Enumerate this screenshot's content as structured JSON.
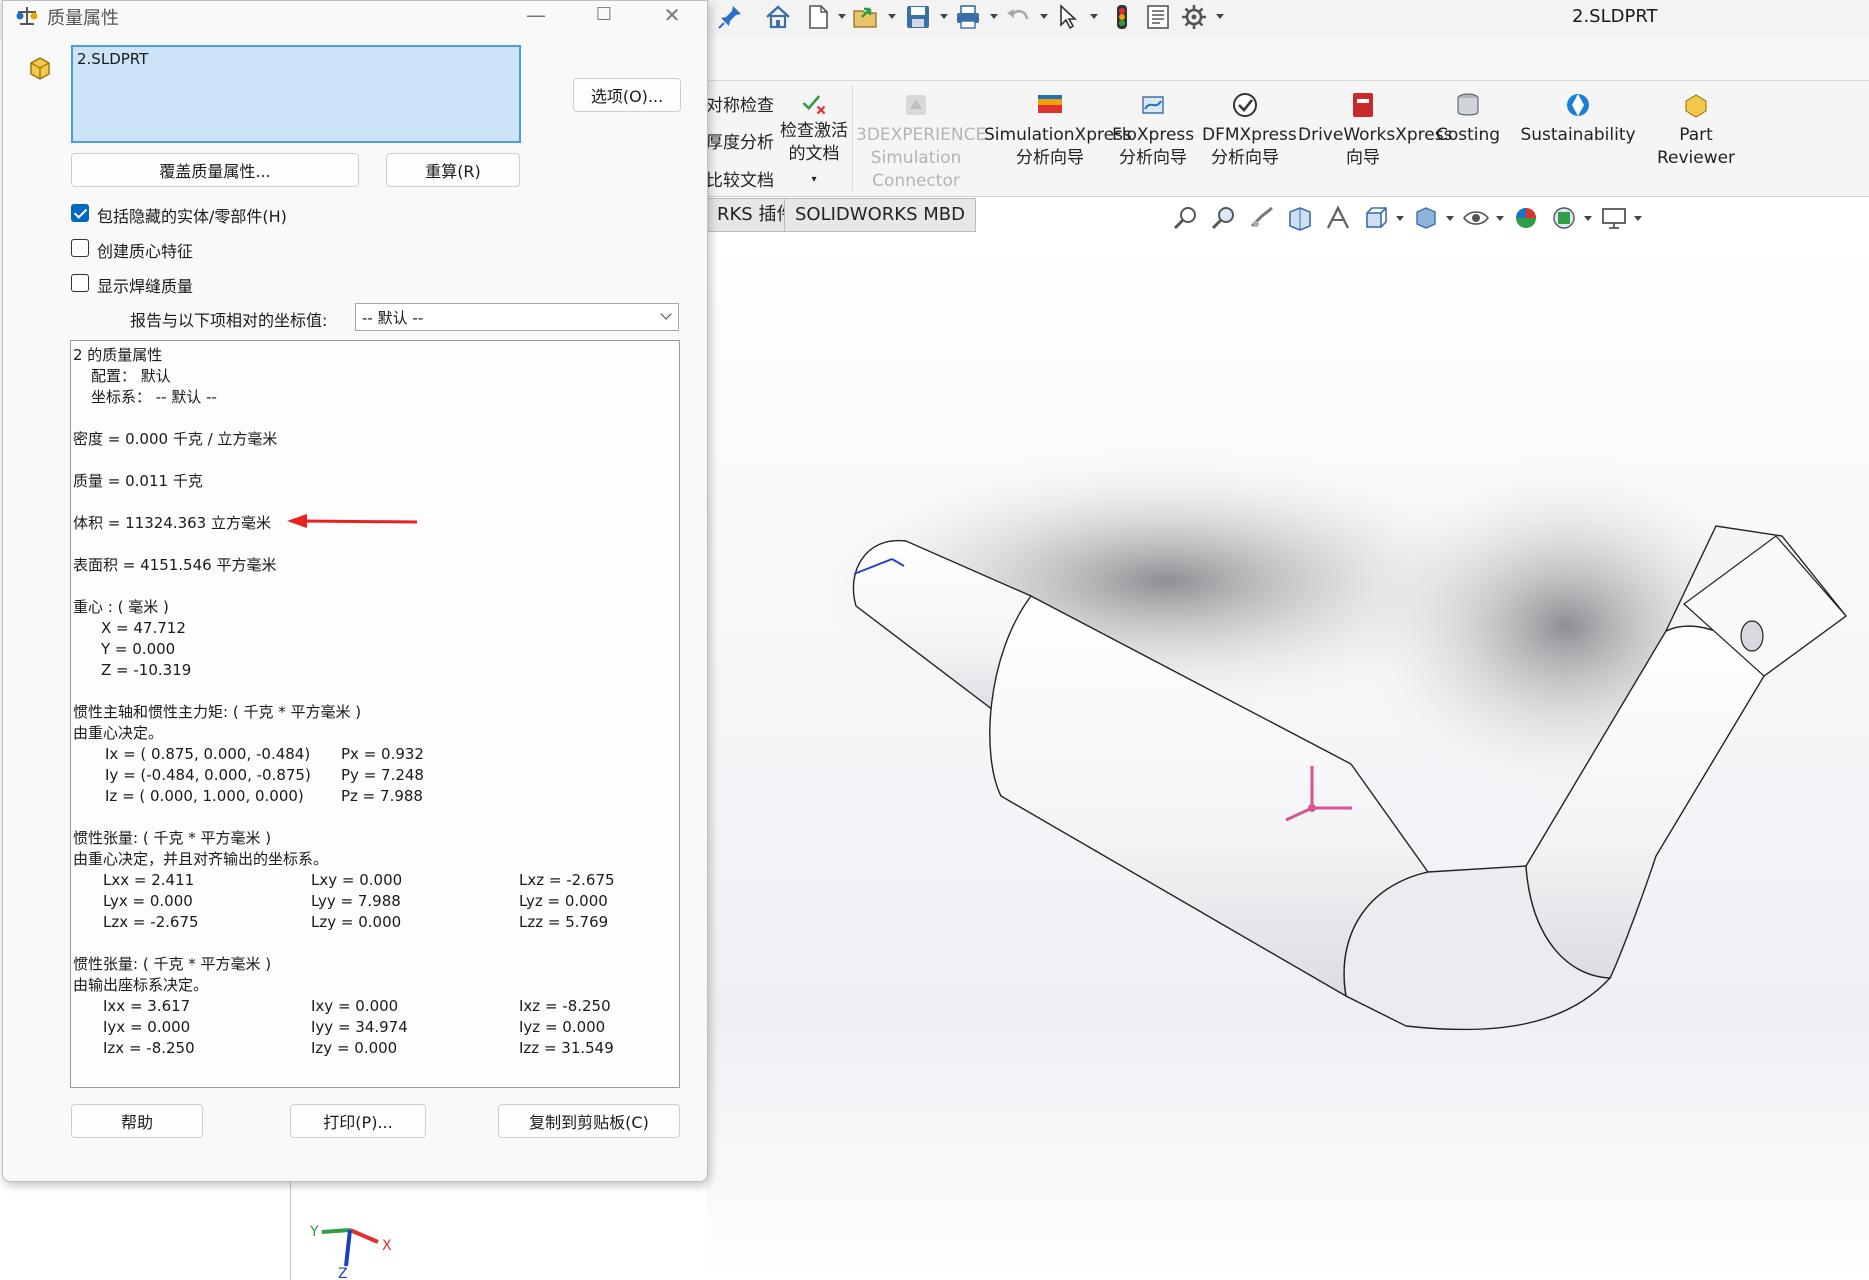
{
  "toolbar": {
    "doc_title": "2.SLDPRT"
  },
  "ribbon": {
    "left_items": [
      "对称检查",
      "厚度分析",
      "比较文档"
    ],
    "check_active_label": "检查激活\n的文档",
    "buttons": [
      {
        "label": "3DEXPERIENCE\nSimulation\nConnector",
        "disabled": true,
        "icon": "3dexperience-icon"
      },
      {
        "label": "SimulationXpress\n分析向导",
        "icon": "simulationxpress-icon"
      },
      {
        "label": "FloXpress\n分析向导",
        "icon": "floxpress-icon"
      },
      {
        "label": "DFMXpress\n分析向导",
        "icon": "dfmxpress-icon"
      },
      {
        "label": "DriveWorksXpress\n向导",
        "icon": "driveworksxpress-icon"
      },
      {
        "label": "Costing",
        "icon": "costing-icon"
      },
      {
        "label": "Sustainability",
        "icon": "sustainability-icon"
      },
      {
        "label": "Part\nReviewer",
        "icon": "part-reviewer-icon"
      }
    ]
  },
  "tabs": [
    "RKS 插件",
    "SOLIDWORKS MBD"
  ],
  "dialog": {
    "title": "质量属性",
    "selection": "2.SLDPRT",
    "options_button": "选项(O)...",
    "override_button": "覆盖质量属性...",
    "recalc_button": "重算(R)",
    "checkboxes": [
      {
        "label": "包括隐藏的实体/零部件(H)",
        "checked": true
      },
      {
        "label": "创建质心特征",
        "checked": false
      },
      {
        "label": "显示焊缝质量",
        "checked": false
      }
    ],
    "coord_label": "报告与以下项相对的坐标值:",
    "coord_value": "-- 默认 --",
    "help_button": "帮助",
    "print_button": "打印(P)...",
    "copy_button": "复制到剪贴板(C)"
  },
  "results": {
    "title": "2 的质量属性",
    "config": "配置： 默认",
    "coord_sys": "坐标系： -- 默认 --",
    "density": "密度 = 0.000 千克 / 立方毫米",
    "mass": "质量 = 0.011 千克",
    "volume": "体积 = 11324.363 立方毫米",
    "surface_area": "表面积 = 4151.546  平方毫米",
    "cog_header": "重心 : ( 毫米 )",
    "cog_x": "X = 47.712",
    "cog_y": "Y = 0.000",
    "cog_z": "Z = -10.319",
    "principal_header": "惯性主轴和惯性主力矩: ( 千克 *  平方毫米 )",
    "principal_sub": "由重心决定。",
    "principal_rows": [
      {
        "axis": "Ix = ( 0.875,  0.000, -0.484)",
        "p": "Px = 0.932"
      },
      {
        "axis": "Iy = (-0.484,  0.000, -0.875)",
        "p": "Py = 7.248"
      },
      {
        "axis": "Iz = ( 0.000,  1.000,  0.000)",
        "p": "Pz = 7.988"
      }
    ],
    "tensor_cog_header": "惯性张量: ( 千克 *  平方毫米 )",
    "tensor_cog_sub": "由重心决定，并且对齐输出的坐标系。",
    "tensor_cog_rows": [
      [
        "Lxx = 2.411",
        "Lxy = 0.000",
        "Lxz = -2.675"
      ],
      [
        "Lyx = 0.000",
        "Lyy = 7.988",
        "Lyz = 0.000"
      ],
      [
        "Lzx = -2.675",
        "Lzy = 0.000",
        "Lzz = 5.769"
      ]
    ],
    "tensor_out_header": "惯性张量: ( 千克 *  平方毫米 )",
    "tensor_out_sub": "由输出座标系决定。",
    "tensor_out_rows": [
      [
        "Ixx = 3.617",
        "Ixy = 0.000",
        "Ixz = -8.250"
      ],
      [
        "Iyx = 0.000",
        "Iyy = 34.974",
        "Iyz = 0.000"
      ],
      [
        "Izx = -8.250",
        "Izy = 0.000",
        "Izz = 31.549"
      ]
    ]
  },
  "viewport": {
    "origin_labels": {
      "y": "Y",
      "x": "X",
      "z": "Z"
    }
  },
  "colors": {
    "accent": "#0067c0",
    "selection_bg": "#cce4f7",
    "annotation_arrow": "#e8231f"
  }
}
